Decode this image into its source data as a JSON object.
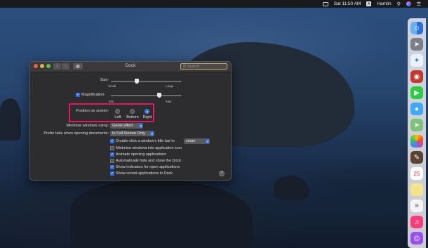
{
  "menubar": {
    "time": "Sat 11:50 AM",
    "user_badge": "A",
    "user": "Hamlin"
  },
  "window": {
    "title": "Dock",
    "search_placeholder": "Search",
    "size": {
      "label": "Size:",
      "min_label": "Small",
      "max_label": "Large",
      "value": 0.42
    },
    "magnification": {
      "label": "Magnification:",
      "checked": true,
      "min_label": "Min",
      "max_label": "Max",
      "value": 0.78
    },
    "position": {
      "label": "Position on screen:",
      "options": [
        "Left",
        "Bottom",
        "Right"
      ],
      "selected": "Right"
    },
    "minimise": {
      "label": "Minimise windows using:",
      "value": "Genie effect"
    },
    "prefer_tabs": {
      "label": "Prefer tabs when opening documents:",
      "value": "In Full Screen Only"
    },
    "checkboxes": [
      {
        "label": "Double-click a window's title bar to",
        "checked": true
      },
      {
        "label": "Minimise windows into application icon",
        "checked": false
      },
      {
        "label": "Animate opening applications",
        "checked": true
      },
      {
        "label": "Automatically hide and show the Dock",
        "checked": false
      },
      {
        "label": "Show indicators for open applications",
        "checked": true
      },
      {
        "label": "Show recent applications in Dock",
        "checked": true
      }
    ],
    "double_click_action": "zoom",
    "help": "?"
  },
  "dock": {
    "apps": [
      "finder-icon",
      "launchpad-icon",
      "safari-icon",
      "photo-booth-icon",
      "facetime-icon",
      "messages-icon",
      "maps-icon",
      "photos-icon",
      "notes-icon",
      "calendar-icon",
      "stickies-icon",
      "reminders-icon",
      "itunes-icon",
      "podcasts-icon"
    ],
    "calendar_day": "25"
  },
  "colors": {
    "accent": "#2f6ee0",
    "highlight": "#e2185a"
  }
}
